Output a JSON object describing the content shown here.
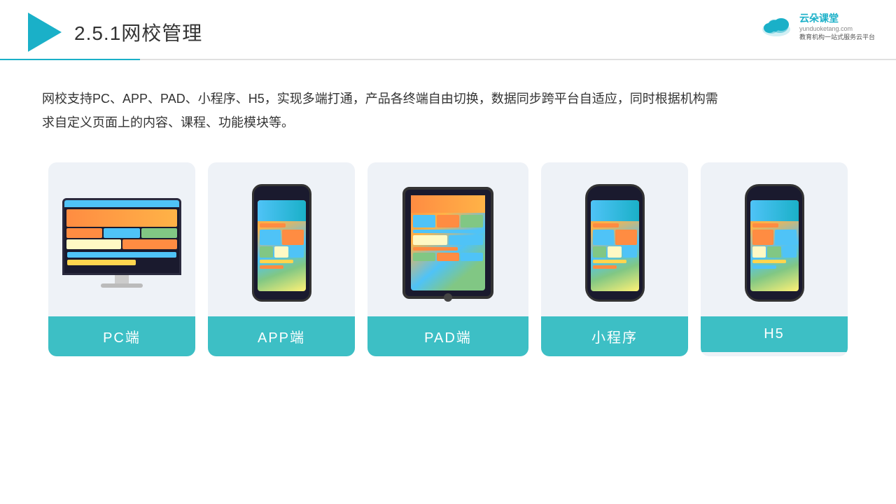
{
  "header": {
    "title": "2.5.1网校管理",
    "number": "2.5.1",
    "name": "网校管理"
  },
  "brand": {
    "name": "云朵课堂",
    "url": "yunduoketang.com",
    "slogan": "教育机构一站式服务云平台"
  },
  "description": "网校支持PC、APP、PAD、小程序、H5，实现多端打通，产品各终端自由切换，数据同步跨平台自适应，同时根据机构需求自定义页面上的内容、课程、功能模块等。",
  "cards": [
    {
      "id": "pc",
      "label": "PC端",
      "type": "pc"
    },
    {
      "id": "app",
      "label": "APP端",
      "type": "phone"
    },
    {
      "id": "pad",
      "label": "PAD端",
      "type": "tablet"
    },
    {
      "id": "miniprogram",
      "label": "小程序",
      "type": "phone"
    },
    {
      "id": "h5",
      "label": "H5",
      "type": "phone"
    }
  ],
  "colors": {
    "accent": "#1ab0c8",
    "card_bg": "#eef2f7",
    "label_bg": "#3dbfc5",
    "device_dark": "#1a1a2e"
  }
}
